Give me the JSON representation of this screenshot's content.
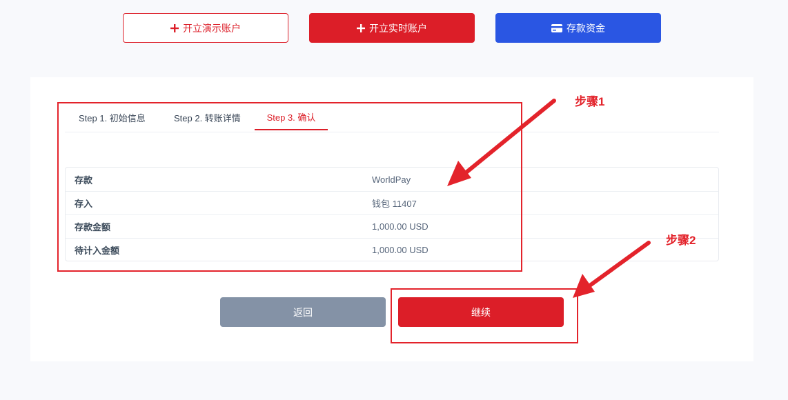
{
  "top_actions": {
    "demo_label": "开立演示账户",
    "live_label": "开立实时账户",
    "deposit_label": "存款资金"
  },
  "tabs": [
    {
      "label": "Step 1. 初始信息"
    },
    {
      "label": "Step 2. 转账详情"
    },
    {
      "label": "Step 3. 确认",
      "active": true
    }
  ],
  "summary": [
    {
      "key": "存款",
      "value": "WorldPay"
    },
    {
      "key": "存入",
      "value": "钱包 11407"
    },
    {
      "key": "存款金额",
      "value": "1,000.00 USD"
    },
    {
      "key": "待计入金额",
      "value": "1,000.00 USD"
    }
  ],
  "actions": {
    "back_label": "返回",
    "continue_label": "继续"
  },
  "annotations": {
    "step1": "步骤1",
    "step2": "步骤2"
  },
  "colors": {
    "brand_red": "#dc1e28",
    "deposit_blue": "#2a56e3",
    "back_gray": "#8492a6",
    "annotation_red": "#e3232b"
  }
}
